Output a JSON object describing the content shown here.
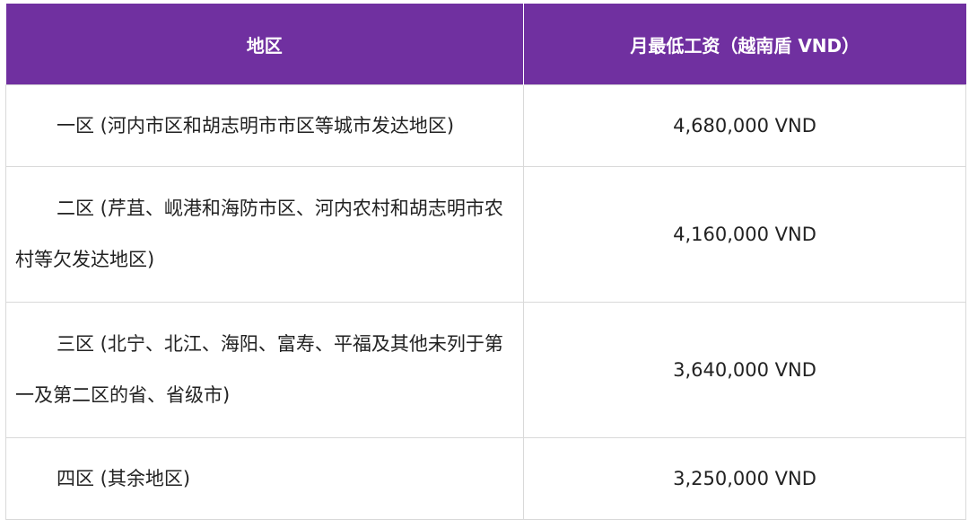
{
  "table": {
    "headers": [
      "地区",
      "月最低工资（越南盾 VND）"
    ],
    "rows": [
      {
        "region": "一区 (河内市区和胡志明市市区等城市发达地区)",
        "wage": "4,680,000 VND"
      },
      {
        "region": "二区 (芹苴、岘港和海防市区、河内农村和胡志明市农村等欠发达地区)",
        "wage": "4,160,000 VND"
      },
      {
        "region": "三区 (北宁、北江、海阳、富寿、平福及其他未列于第一及第二区的省、省级市)",
        "wage": "3,640,000 VND"
      },
      {
        "region": "四区 (其余地区)",
        "wage": "3,250,000 VND"
      }
    ]
  },
  "colors": {
    "header_bg": "#7030a0",
    "header_text": "#ffffff",
    "border": "#d9d9d9"
  }
}
